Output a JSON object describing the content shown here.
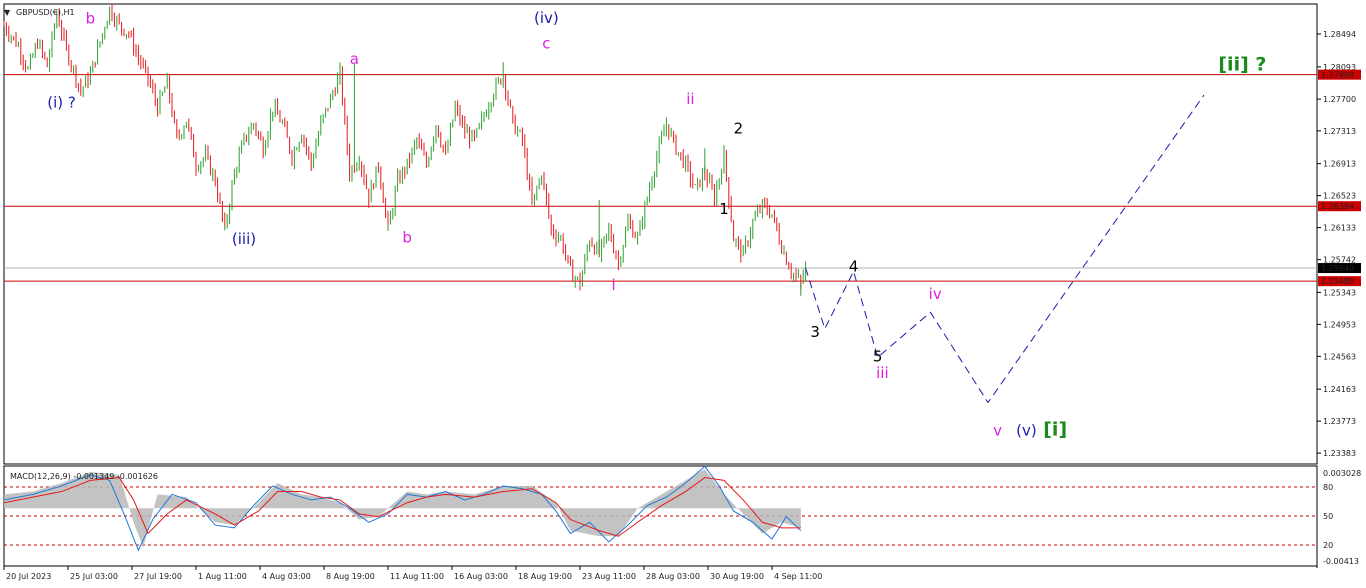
{
  "chart_data": [
    {
      "type": "candlestick",
      "title": "GBPUSD(€),H1",
      "y_ticks": [
        "1.28494",
        "1.28093",
        "1.27700",
        "1.27313",
        "1.26913",
        "1.26523",
        "1.26133",
        "1.25742",
        "1.25343",
        "1.24953",
        "1.24563",
        "1.24163",
        "1.23773",
        "1.23383"
      ],
      "ylim": [
        1.2325,
        1.2886
      ],
      "x_ticks": [
        "20 Jul 2023",
        "25 Jul 03:00",
        "27 Jul 19:00",
        "1 Aug 11:00",
        "4 Aug 03:00",
        "8 Aug 19:00",
        "11 Aug 11:00",
        "16 Aug 03:00",
        "18 Aug 19:00",
        "23 Aug 11:00",
        "28 Aug 03:00",
        "30 Aug 19:00",
        "4 Sep 11:00"
      ],
      "horizontal_levels": [
        {
          "value": 1.27998,
          "label": "1.27998",
          "color": "#cc0000"
        },
        {
          "value": 1.26394,
          "label": "1.26394",
          "color": "#cc0000"
        },
        {
          "value": 1.2548,
          "label": "1.25480",
          "color": "#cc0000"
        },
        {
          "value": 1.2564,
          "label": "1.25640",
          "color": "#b0b0b0",
          "current_price": true
        }
      ],
      "candle_colors": {
        "up": "#2aa02a",
        "down": "#e41a1c"
      },
      "price_path": [
        [
          0,
          1.286
        ],
        [
          3,
          1.2835
        ],
        [
          5,
          1.2805
        ],
        [
          7,
          1.284
        ],
        [
          9,
          1.281
        ],
        [
          11,
          1.2875
        ],
        [
          13,
          1.283
        ],
        [
          16,
          1.278
        ],
        [
          18,
          1.28
        ],
        [
          20,
          1.284
        ],
        [
          22,
          1.288
        ],
        [
          24,
          1.286
        ],
        [
          26,
          1.285
        ],
        [
          28,
          1.282
        ],
        [
          30,
          1.2795
        ],
        [
          32,
          1.276
        ],
        [
          34,
          1.279
        ],
        [
          36,
          1.272
        ],
        [
          38,
          1.2745
        ],
        [
          40,
          1.269
        ],
        [
          42,
          1.27
        ],
        [
          44,
          1.267
        ],
        [
          46,
          1.261
        ],
        [
          48,
          1.268
        ],
        [
          50,
          1.272
        ],
        [
          52,
          1.274
        ],
        [
          54,
          1.271
        ],
        [
          56,
          1.276
        ],
        [
          58,
          1.274
        ],
        [
          60,
          1.27
        ],
        [
          62,
          1.273
        ],
        [
          64,
          1.269
        ],
        [
          66,
          1.274
        ],
        [
          68,
          1.277
        ],
        [
          70,
          1.28
        ],
        [
          72,
          1.268
        ],
        [
          74,
          1.27
        ],
        [
          76,
          1.265
        ],
        [
          78,
          1.269
        ],
        [
          80,
          1.261
        ],
        [
          82,
          1.267
        ],
        [
          84,
          1.269
        ],
        [
          86,
          1.272
        ],
        [
          88,
          1.269
        ],
        [
          90,
          1.274
        ],
        [
          92,
          1.27
        ],
        [
          94,
          1.276
        ],
        [
          96,
          1.273
        ],
        [
          98,
          1.272
        ],
        [
          100,
          1.275
        ],
        [
          102,
          1.278
        ],
        [
          104,
          1.28
        ],
        [
          106,
          1.274
        ],
        [
          108,
          1.272
        ],
        [
          110,
          1.264
        ],
        [
          112,
          1.268
        ],
        [
          114,
          1.261
        ],
        [
          116,
          1.26
        ],
        [
          118,
          1.256
        ],
        [
          120,
          1.2545
        ],
        [
          122,
          1.26
        ],
        [
          124,
          1.258
        ],
        [
          126,
          1.261
        ],
        [
          128,
          1.257
        ],
        [
          130,
          1.262
        ],
        [
          132,
          1.26
        ],
        [
          134,
          1.265
        ],
        [
          136,
          1.27
        ],
        [
          138,
          1.274
        ],
        [
          140,
          1.271
        ],
        [
          142,
          1.269
        ],
        [
          144,
          1.266
        ],
        [
          146,
          1.268
        ],
        [
          148,
          1.265
        ],
        [
          150,
          1.27
        ],
        [
          152,
          1.26
        ],
        [
          154,
          1.258
        ],
        [
          156,
          1.262
        ],
        [
          158,
          1.264
        ],
        [
          160,
          1.263
        ],
        [
          162,
          1.259
        ],
        [
          164,
          1.256
        ],
        [
          166,
          1.2545
        ],
        [
          167,
          1.2564
        ]
      ],
      "projection": [
        [
          167,
          1.2564
        ],
        [
          171,
          1.249
        ],
        [
          177,
          1.256
        ],
        [
          182,
          1.2455
        ],
        [
          193,
          1.251
        ],
        [
          205,
          1.24
        ],
        [
          250,
          1.2775
        ]
      ],
      "wave_labels": [
        {
          "text": "b",
          "x": 18,
          "y": 1.2862,
          "color": "#e020e0"
        },
        {
          "text": "(i) ?",
          "x": 12,
          "y": 1.276,
          "color": "#1a1ab0"
        },
        {
          "text": "(iii)",
          "x": 50,
          "y": 1.2593,
          "color": "#1a1ab0"
        },
        {
          "text": "a",
          "x": 73,
          "y": 1.2813,
          "color": "#e020e0"
        },
        {
          "text": "b",
          "x": 84,
          "y": 1.2595,
          "color": "#e020e0"
        },
        {
          "text": "(iv)",
          "x": 113,
          "y": 1.2863,
          "color": "#1a1ab0"
        },
        {
          "text": "c",
          "x": 113,
          "y": 1.2832,
          "color": "#e020e0"
        },
        {
          "text": "i",
          "x": 127,
          "y": 1.2537,
          "color": "#e020e0"
        },
        {
          "text": "ii",
          "x": 143,
          "y": 1.2764,
          "color": "#e020e0"
        },
        {
          "text": "2",
          "x": 153,
          "y": 1.2728,
          "color": "#000000"
        },
        {
          "text": "1",
          "x": 150,
          "y": 1.263,
          "color": "#000000"
        },
        {
          "text": "4",
          "x": 177,
          "y": 1.256,
          "color": "#000000"
        },
        {
          "text": "3",
          "x": 169,
          "y": 1.248,
          "color": "#000000"
        },
        {
          "text": "5",
          "x": 182,
          "y": 1.245,
          "color": "#000000"
        },
        {
          "text": "iii",
          "x": 183,
          "y": 1.243,
          "color": "#e020e0"
        },
        {
          "text": "iv",
          "x": 194,
          "y": 1.2526,
          "color": "#e020e0"
        },
        {
          "text": "v",
          "x": 207,
          "y": 1.236,
          "color": "#e020e0"
        },
        {
          "text": "(v)",
          "x": 213,
          "y": 1.236,
          "color": "#1a1ab0"
        },
        {
          "text": "[i]",
          "x": 219,
          "y": 1.236,
          "color": "#1a8a1a"
        },
        {
          "text": "[ii] ?",
          "x": 258,
          "y": 1.2805,
          "color": "#1a8a1a"
        }
      ]
    },
    {
      "type": "line",
      "title": "MACD(12,26,9) -0.001349 -0.001626",
      "y_ticks": [
        "0.003028",
        "80",
        "50",
        "20",
        "-0.00413"
      ],
      "levels": [
        80,
        50,
        20
      ],
      "ylim": [
        -0.00413,
        0.003028
      ],
      "series": [
        {
          "kind": "histogram",
          "color": "#b8b8b8",
          "points": [
            [
              0,
              0.001
            ],
            [
              6,
              0.0012
            ],
            [
              12,
              0.0018
            ],
            [
              18,
              0.0026
            ],
            [
              24,
              0.0024
            ],
            [
              27,
              -0.001
            ],
            [
              29,
              -0.0028
            ],
            [
              32,
              0.001
            ],
            [
              38,
              0.0008
            ],
            [
              44,
              -0.001
            ],
            [
              48,
              -0.0012
            ],
            [
              53,
              0.0004
            ],
            [
              57,
              0.0018
            ],
            [
              62,
              0.001
            ],
            [
              66,
              0.0008
            ],
            [
              70,
              0.0004
            ],
            [
              74,
              -0.0008
            ],
            [
              78,
              -0.0006
            ],
            [
              84,
              0.0012
            ],
            [
              88,
              0.001
            ],
            [
              92,
              0.0012
            ],
            [
              98,
              0.001
            ],
            [
              104,
              0.0016
            ],
            [
              110,
              0.0016
            ],
            [
              115,
              0.0004
            ],
            [
              118,
              -0.0016
            ],
            [
              124,
              -0.002
            ],
            [
              128,
              -0.002
            ],
            [
              132,
              0.0
            ],
            [
              137,
              0.001
            ],
            [
              142,
              0.002
            ],
            [
              146,
              0.0028
            ],
            [
              150,
              0.001
            ],
            [
              154,
              -0.0004
            ],
            [
              158,
              -0.0018
            ],
            [
              162,
              -0.001
            ],
            [
              166,
              -0.0014
            ]
          ]
        },
        {
          "kind": "line",
          "name": "MACD",
          "color": "#1e78d8",
          "points": [
            [
              0,
              0.0006
            ],
            [
              6,
              0.001
            ],
            [
              12,
              0.0016
            ],
            [
              18,
              0.0024
            ],
            [
              22,
              0.002
            ],
            [
              25,
              -0.0004
            ],
            [
              28,
              -0.003
            ],
            [
              31,
              -0.0008
            ],
            [
              35,
              0.001
            ],
            [
              40,
              0.0004
            ],
            [
              44,
              -0.0012
            ],
            [
              48,
              -0.0014
            ],
            [
              52,
              0.0002
            ],
            [
              56,
              0.0016
            ],
            [
              60,
              0.001
            ],
            [
              64,
              0.0006
            ],
            [
              68,
              0.0008
            ],
            [
              72,
              0.0
            ],
            [
              76,
              -0.001
            ],
            [
              80,
              -0.0004
            ],
            [
              84,
              0.001
            ],
            [
              88,
              0.0008
            ],
            [
              92,
              0.0012
            ],
            [
              96,
              0.0006
            ],
            [
              100,
              0.001
            ],
            [
              104,
              0.0016
            ],
            [
              108,
              0.0014
            ],
            [
              112,
              0.001
            ],
            [
              115,
              -0.0002
            ],
            [
              118,
              -0.0018
            ],
            [
              122,
              -0.001
            ],
            [
              126,
              -0.0024
            ],
            [
              130,
              -0.0012
            ],
            [
              134,
              0.0002
            ],
            [
              138,
              0.0008
            ],
            [
              142,
              0.0018
            ],
            [
              146,
              0.003
            ],
            [
              149,
              0.0016
            ],
            [
              152,
              -0.0002
            ],
            [
              156,
              -0.001
            ],
            [
              160,
              -0.0022
            ],
            [
              163,
              -0.0006
            ],
            [
              166,
              -0.0016
            ]
          ]
        },
        {
          "kind": "line",
          "name": "Signal",
          "color": "#e41a1c",
          "points": [
            [
              0,
              0.0004
            ],
            [
              6,
              0.0008
            ],
            [
              12,
              0.0012
            ],
            [
              18,
              0.002
            ],
            [
              24,
              0.0022
            ],
            [
              27,
              0.0006
            ],
            [
              30,
              -0.0018
            ],
            [
              34,
              -0.0004
            ],
            [
              38,
              0.0006
            ],
            [
              44,
              -0.0004
            ],
            [
              48,
              -0.0012
            ],
            [
              53,
              -0.0002
            ],
            [
              57,
              0.0012
            ],
            [
              62,
              0.0012
            ],
            [
              66,
              0.0008
            ],
            [
              70,
              0.0006
            ],
            [
              74,
              -0.0004
            ],
            [
              78,
              -0.0006
            ],
            [
              84,
              0.0004
            ],
            [
              88,
              0.0008
            ],
            [
              92,
              0.001
            ],
            [
              98,
              0.0008
            ],
            [
              104,
              0.0012
            ],
            [
              110,
              0.0014
            ],
            [
              115,
              0.0004
            ],
            [
              118,
              -0.0008
            ],
            [
              124,
              -0.0016
            ],
            [
              128,
              -0.002
            ],
            [
              132,
              -0.001
            ],
            [
              137,
              0.0002
            ],
            [
              142,
              0.0012
            ],
            [
              146,
              0.0022
            ],
            [
              150,
              0.002
            ],
            [
              154,
              0.0006
            ],
            [
              158,
              -0.001
            ],
            [
              162,
              -0.0014
            ],
            [
              166,
              -0.0014
            ]
          ]
        }
      ]
    }
  ],
  "ui": {
    "menu_marker": "▼"
  }
}
